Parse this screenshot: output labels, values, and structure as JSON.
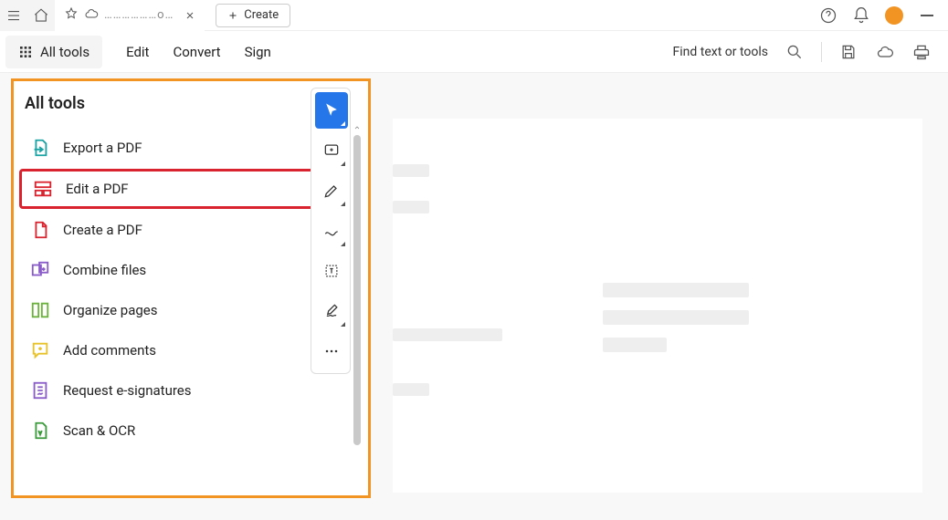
{
  "titlebar": {
    "tab_title": "………………o…",
    "create_label": "Create"
  },
  "menubar": {
    "all_tools": "All tools",
    "items": [
      "Edit",
      "Convert",
      "Sign"
    ],
    "search_placeholder": "Find text or tools"
  },
  "panel": {
    "title": "All tools",
    "tools": [
      {
        "label": "Export a PDF",
        "icon": "export-pdf-icon",
        "color": "#1aa3a3"
      },
      {
        "label": "Edit a PDF",
        "icon": "edit-pdf-icon",
        "color": "#d9232e",
        "highlight": true
      },
      {
        "label": "Create a PDF",
        "icon": "create-pdf-icon",
        "color": "#d9232e"
      },
      {
        "label": "Combine files",
        "icon": "combine-icon",
        "color": "#8a5cc9"
      },
      {
        "label": "Organize pages",
        "icon": "organize-icon",
        "color": "#6bb23a"
      },
      {
        "label": "Add comments",
        "icon": "comment-icon",
        "color": "#e8c22a"
      },
      {
        "label": "Request e-signatures",
        "icon": "esign-icon",
        "color": "#8a5cc9"
      },
      {
        "label": "Scan & OCR",
        "icon": "scan-icon",
        "color": "#3a9b3a"
      }
    ]
  },
  "vtoolbar": {
    "items": [
      {
        "name": "select-tool-icon",
        "active": true
      },
      {
        "name": "add-text-box-icon",
        "active": false
      },
      {
        "name": "highlight-tool-icon",
        "active": false
      },
      {
        "name": "draw-tool-icon",
        "active": false
      },
      {
        "name": "text-select-icon",
        "active": false
      },
      {
        "name": "fill-sign-icon",
        "active": false
      },
      {
        "name": "more-tools-icon",
        "active": false
      }
    ]
  }
}
